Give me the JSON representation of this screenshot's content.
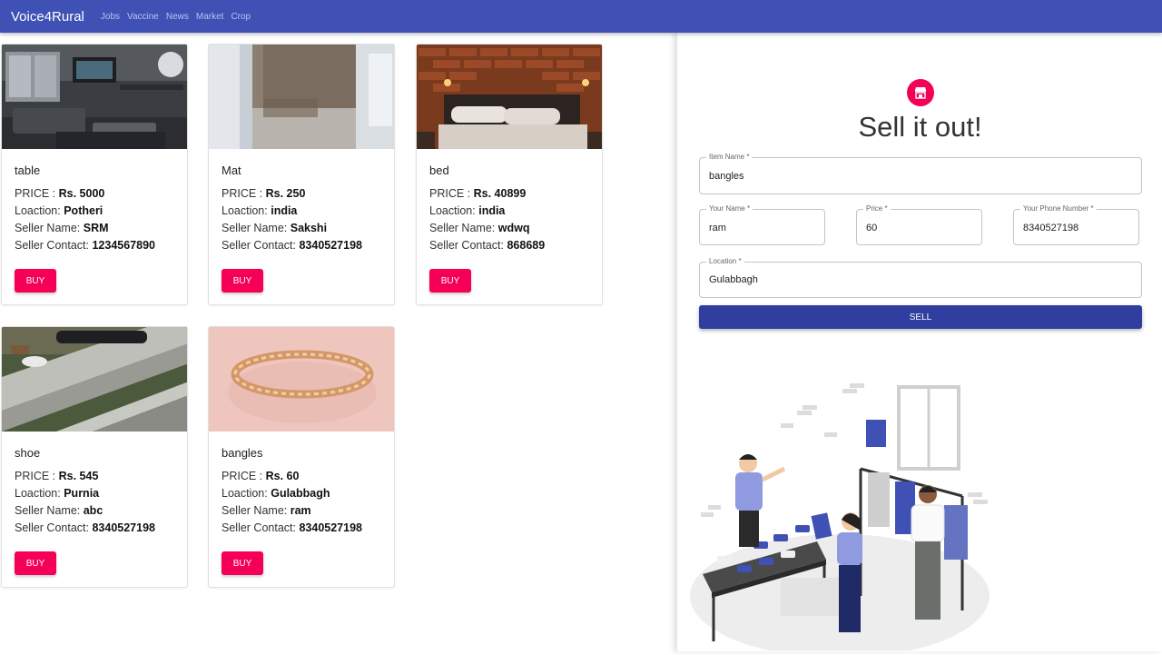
{
  "appbar": {
    "brand": "Voice4Rural",
    "links": [
      "Jobs",
      "Vaccine",
      "News",
      "Market",
      "Crop"
    ]
  },
  "labels": {
    "price": "PRICE : ",
    "location": "Loaction: ",
    "seller_name": "Seller Name: ",
    "seller_contact": "Seller Contact: ",
    "buy": "BUY"
  },
  "products": [
    {
      "name": "table",
      "price": "Rs. 5000",
      "location": "Potheri",
      "seller": "SRM",
      "contact": "1234567890",
      "image": "living-room-image"
    },
    {
      "name": "Mat",
      "price": "Rs. 250",
      "location": "india",
      "seller": "Sakshi",
      "contact": "8340527198",
      "image": "mat-image"
    },
    {
      "name": "bed",
      "price": "Rs. 40899",
      "location": "india",
      "seller": "wdwq",
      "contact": "868689",
      "image": "bed-image"
    },
    {
      "name": "shoe",
      "price": "Rs. 545",
      "location": "Purnia",
      "seller": "abc",
      "contact": "8340527198",
      "image": "shoe-image"
    },
    {
      "name": "bangles",
      "price": "Rs. 60",
      "location": "Gulabbagh",
      "seller": "ram",
      "contact": "8340527198",
      "image": "bangle-image"
    }
  ],
  "sell_form": {
    "title": "Sell it out!",
    "item_name": {
      "label": "Item Name *",
      "value": "bangles"
    },
    "your_name": {
      "label": "Your Name *",
      "value": "ram"
    },
    "price": {
      "label": "Price *",
      "value": "60"
    },
    "phone": {
      "label": "Your Phone Number *",
      "value": "8340527198"
    },
    "location": {
      "label": "Location *",
      "value": "Gulabbagh"
    },
    "submit": "SELL",
    "icon": "store-icon"
  },
  "colors": {
    "appbar": "#3f51b5",
    "buy_button": "#f50057",
    "sell_button": "#303f9f"
  }
}
